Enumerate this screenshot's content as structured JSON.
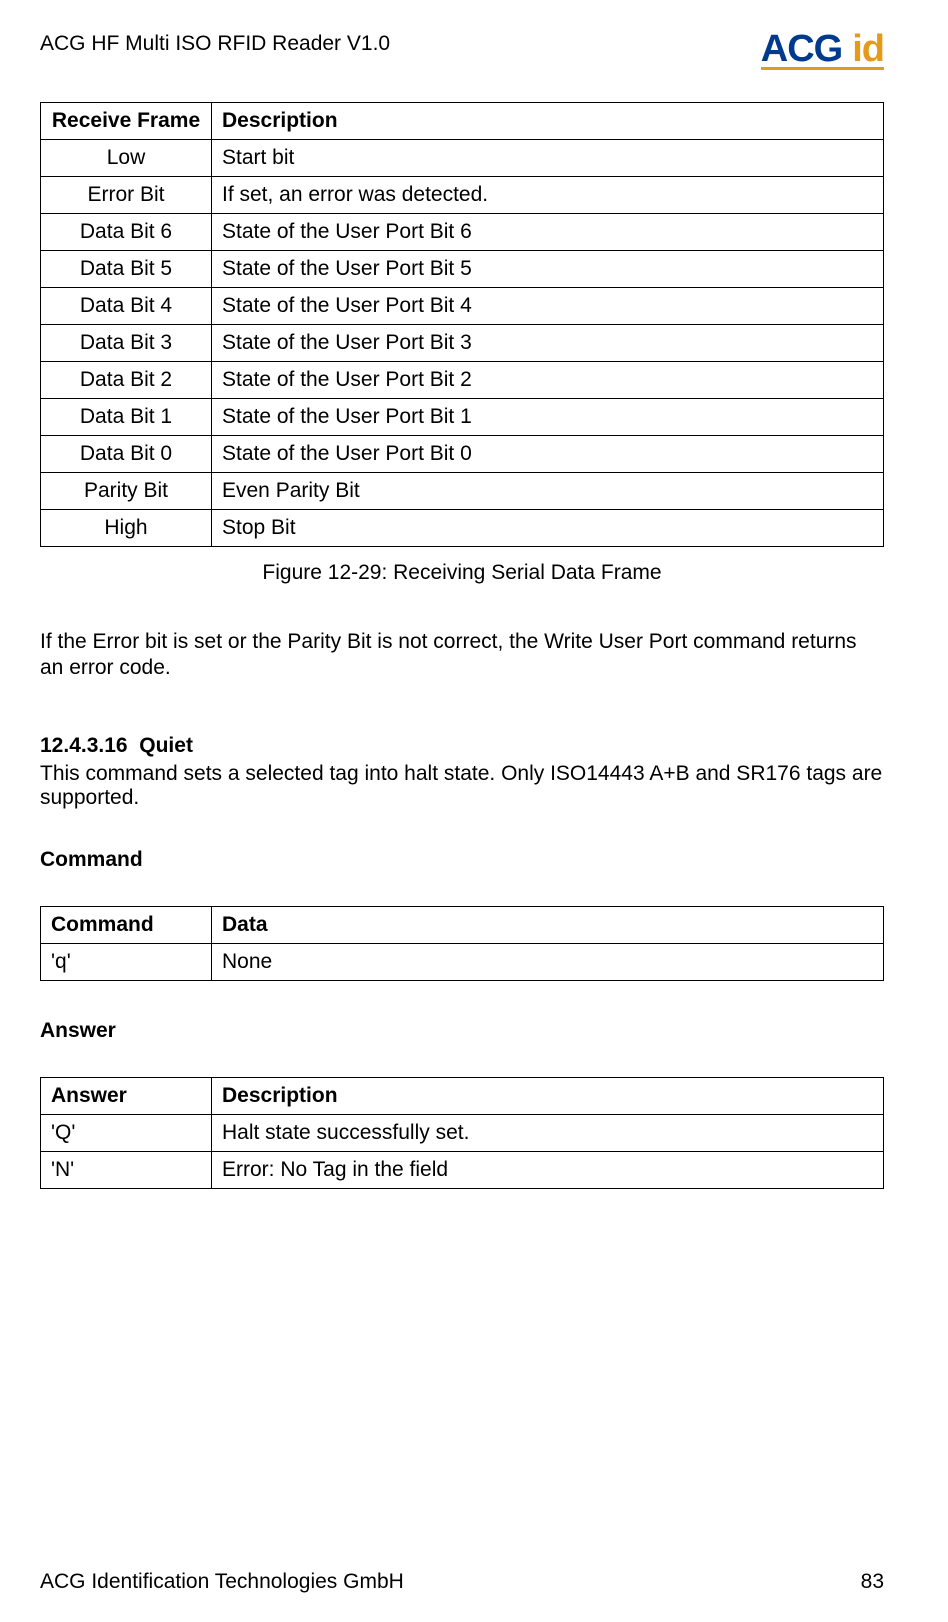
{
  "header": {
    "title": "ACG HF Multi ISO RFID Reader V1.0",
    "logo_acg": "ACG",
    "logo_id": "id"
  },
  "frame_table": {
    "headers": [
      "Receive Frame",
      "Description"
    ],
    "rows": [
      [
        "Low",
        "Start bit"
      ],
      [
        "Error Bit",
        "If set, an error was detected."
      ],
      [
        "Data Bit 6",
        "State of the User Port Bit 6"
      ],
      [
        "Data Bit 5",
        "State of the User Port Bit 5"
      ],
      [
        "Data Bit 4",
        "State of the User Port Bit 4"
      ],
      [
        "Data Bit 3",
        "State of the User Port Bit 3"
      ],
      [
        "Data Bit 2",
        "State of the User Port Bit 2"
      ],
      [
        "Data Bit 1",
        "State of the User Port Bit 1"
      ],
      [
        "Data Bit 0",
        "State of the User Port Bit 0"
      ],
      [
        "Parity Bit",
        "Even Parity Bit"
      ],
      [
        "High",
        "Stop Bit"
      ]
    ]
  },
  "figure_caption": "Figure 12-29: Receiving Serial Data Frame",
  "error_text": "If the Error bit is set or the Parity Bit is not correct, the Write User Port command returns an error code.",
  "section": {
    "number": "12.4.3.16",
    "title": "Quiet",
    "text": "This command sets a selected tag into halt state. Only ISO14443 A+B and SR176 tags are supported."
  },
  "command_heading": "Command",
  "command_table": {
    "headers": [
      "Command",
      "Data"
    ],
    "rows": [
      [
        "'q'",
        "None"
      ]
    ]
  },
  "answer_heading": "Answer",
  "answer_table": {
    "headers": [
      "Answer",
      "Description"
    ],
    "rows": [
      [
        "'Q'",
        "Halt state successfully set."
      ],
      [
        "'N'",
        "Error: No Tag in the field"
      ]
    ]
  },
  "footer": {
    "company": "ACG Identification Technologies GmbH",
    "page": "83"
  }
}
